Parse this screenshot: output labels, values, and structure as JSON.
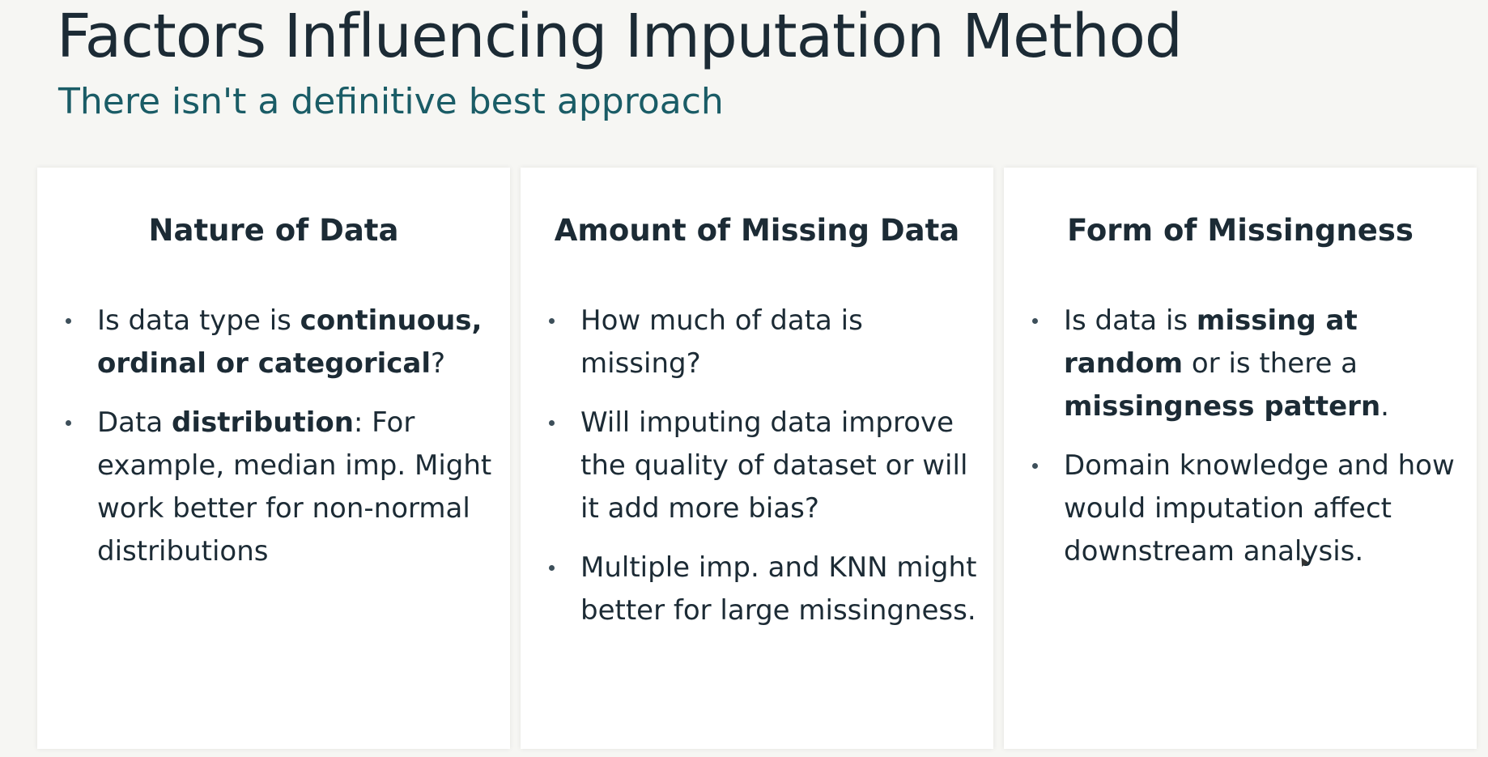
{
  "slide": {
    "title": "Factors Influencing Imputation Method",
    "subtitle": "There isn't a definitive best approach"
  },
  "cards": [
    {
      "title": "Nature of Data",
      "bullets": [
        [
          {
            "t": "Is data type is ",
            "b": false
          },
          {
            "t": "continuous, ordinal or categorical",
            "b": true
          },
          {
            "t": "?",
            "b": false
          }
        ],
        [
          {
            "t": "Data ",
            "b": false
          },
          {
            "t": "distribution",
            "b": true
          },
          {
            "t": ": For example, median imp. Might work better for non-normal distributions",
            "b": false
          }
        ]
      ]
    },
    {
      "title": "Amount of Missing Data",
      "bullets": [
        [
          {
            "t": "How much of data is missing?",
            "b": false
          }
        ],
        [
          {
            "t": "Will imputing data improve the quality of dataset or will it add more bias?",
            "b": false
          }
        ],
        [
          {
            "t": "Multiple imp. and KNN might better for large missingness.",
            "b": false
          }
        ]
      ]
    },
    {
      "title": "Form of Missingness",
      "bullets": [
        [
          {
            "t": "Is data is ",
            "b": false
          },
          {
            "t": "missing at random",
            "b": true
          },
          {
            "t": " or is there a ",
            "b": false
          },
          {
            "t": "missingness pattern",
            "b": true
          },
          {
            "t": ".",
            "b": false
          }
        ],
        [
          {
            "t": "Domain knowledge and how would imputation affect downstream analysis.",
            "b": false
          }
        ]
      ]
    }
  ],
  "icons": {
    "bullet": "bullet-dot",
    "cursor": "mouse-cursor-icon"
  },
  "colors": {
    "title": "#1c2b35",
    "subtitle": "#1a5c66",
    "background": "#f6f6f3",
    "card": "#ffffff"
  }
}
